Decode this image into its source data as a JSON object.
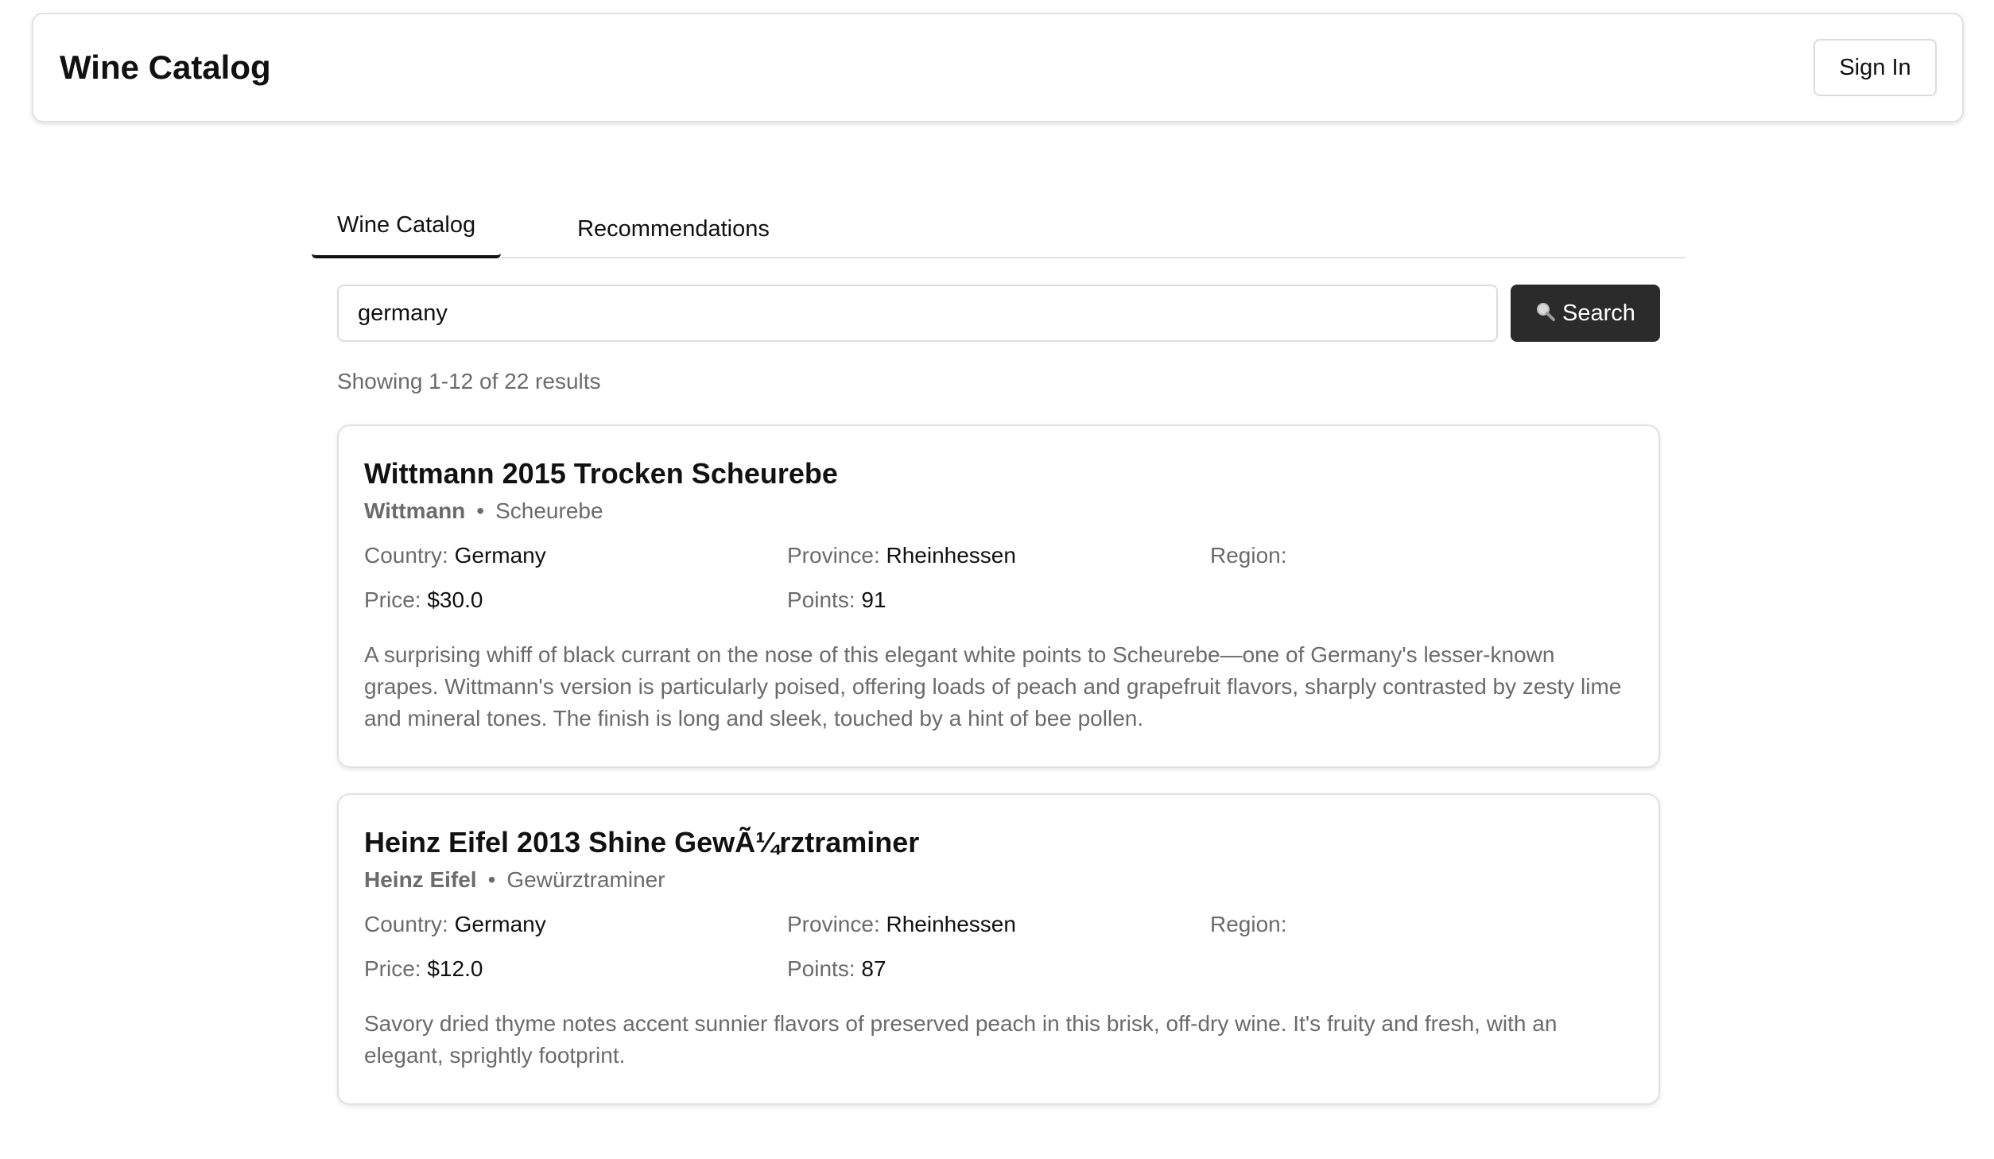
{
  "header": {
    "title": "Wine Catalog",
    "sign_in_label": "Sign In"
  },
  "tabs": [
    {
      "label": "Wine Catalog",
      "active": true
    },
    {
      "label": "Recommendations",
      "active": false
    }
  ],
  "search": {
    "value": "germany",
    "button_label": "Search",
    "button_icon": "magnifier-icon"
  },
  "results": {
    "summary": "Showing 1-12 of 22 results"
  },
  "labels": {
    "country": "Country:",
    "province": "Province:",
    "region": "Region:",
    "price": "Price:",
    "points": "Points:",
    "separator": "•"
  },
  "wines": [
    {
      "title": "Wittmann 2015 Trocken Scheurebe",
      "winery": "Wittmann",
      "variety": "Scheurebe",
      "country": "Germany",
      "province": "Rheinhessen",
      "region": "",
      "price": "$30.0",
      "points": "91",
      "description": "A surprising whiff of black currant on the nose of this elegant white points to Scheurebe—one of Germany's lesser-known grapes. Wittmann's version is particularly poised, offering loads of peach and grapefruit flavors, sharply contrasted by zesty lime and mineral tones. The finish is long and sleek, touched by a hint of bee pollen."
    },
    {
      "title": "Heinz Eifel 2013 Shine GewÃ¼rztraminer",
      "winery": "Heinz Eifel",
      "variety": "Gewürztraminer",
      "country": "Germany",
      "province": "Rheinhessen",
      "region": "",
      "price": "$12.0",
      "points": "87",
      "description": "Savory dried thyme notes accent sunnier flavors of preserved peach in this brisk, off-dry wine. It's fruity and fresh, with an elegant, sprightly footprint."
    }
  ],
  "colors": {
    "button_dark": "#2b2b2b",
    "muted_text": "#6b6b6b",
    "border": "#e2e2e2"
  }
}
